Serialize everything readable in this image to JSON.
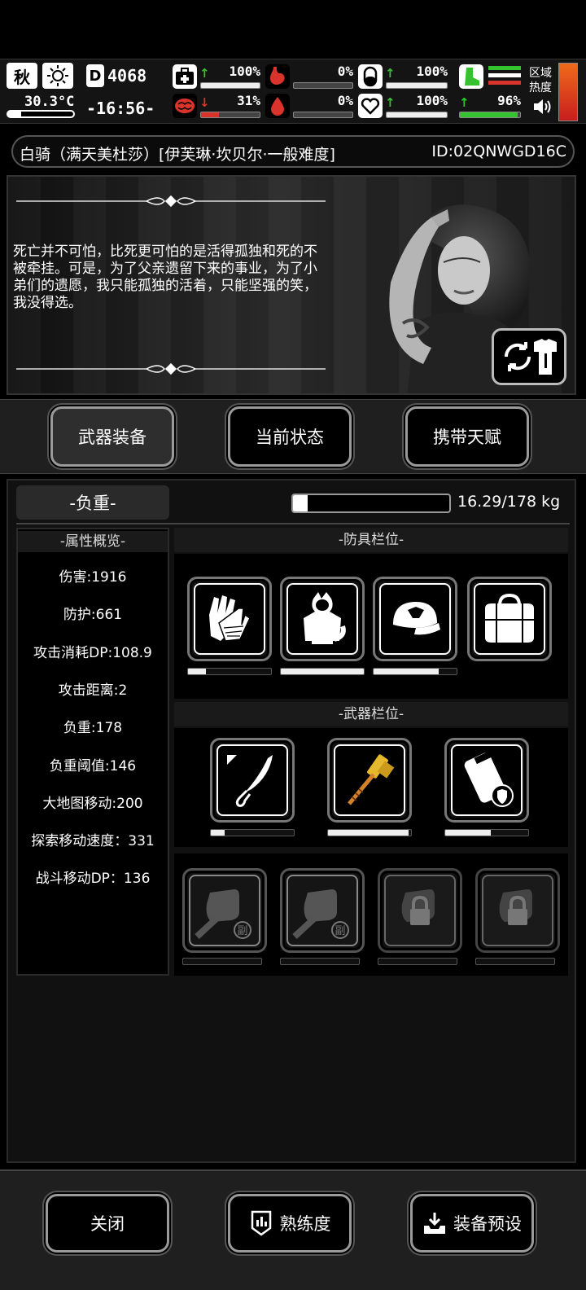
{
  "hud": {
    "season": "秋",
    "temperature": "30.3°C",
    "day": "4068",
    "clock": "-16:56-",
    "zone_label_1": "区域",
    "zone_label_2": "热度",
    "stats": [
      {
        "icon": "medkit-icon",
        "trend": "up",
        "value": "100%",
        "bar": 1.0
      },
      {
        "icon": "stomach-icon",
        "trend": "none",
        "value": "0%",
        "bar": 0.0
      },
      {
        "icon": "pill-icon",
        "trend": "up",
        "value": "100%",
        "bar": 1.0
      },
      {
        "icon": "boot-icon",
        "trend": "none",
        "value": "",
        "bar": 1.0
      },
      {
        "icon": "brain-icon",
        "trend": "down",
        "value": "31%",
        "bar": 0.31
      },
      {
        "icon": "blood-drop-icon",
        "trend": "none",
        "value": "0%",
        "bar": 0.0
      },
      {
        "icon": "heart-icon",
        "trend": "up",
        "value": "100%",
        "bar": 1.0
      },
      {
        "icon": "energy-icon",
        "trend": "up",
        "value": "96%",
        "bar": 0.96
      }
    ]
  },
  "character": {
    "name": "白骑（满天美杜莎）[伊芙琳·坎贝尔·一般难度]",
    "id": "ID:02QNWGD16C",
    "quote": "死亡并不可怕，比死更可怕的是活得孤独和死的不被牵挂。可是，为了父亲遗留下来的事业，为了小弟们的遗愿，我只能孤独的活着，只能坚强的笑，我没得选。"
  },
  "tabs": [
    {
      "label": "武器装备",
      "active": true
    },
    {
      "label": "当前状态",
      "active": false
    },
    {
      "label": "携带天赋",
      "active": false
    }
  ],
  "weight": {
    "label": "-负重-",
    "current": 16.29,
    "max": 178,
    "text": "16.29/178 kg"
  },
  "attributes": {
    "title": "-属性概览-",
    "items": [
      "伤害:1916",
      "防护:661",
      "攻击消耗DP:108.9",
      "攻击距离:2",
      "负重:178",
      "负重阈值:146",
      "大地图移动:200",
      "探索移动速度：331",
      "战斗移动DP：136"
    ]
  },
  "armor": {
    "title": "-防具栏位-",
    "slots": [
      {
        "icon": "gloves-icon",
        "durability": 0.22
      },
      {
        "icon": "hoodie-icon",
        "durability": 1.0
      },
      {
        "icon": "cap-icon",
        "durability": 0.78
      },
      {
        "icon": "bag-icon",
        "durability": 0
      }
    ]
  },
  "weapons": {
    "title": "-武器栏位-",
    "slots": [
      {
        "icon": "curved-blade-icon",
        "durability": 0.17
      },
      {
        "icon": "golden-hammer-icon",
        "durability": 0.97
      },
      {
        "icon": "shield-pack-icon",
        "durability": 0.55
      }
    ]
  },
  "extra_slots": [
    {
      "icon": "fist-icon",
      "badge": "副",
      "locked": false
    },
    {
      "icon": "fist-icon",
      "badge": "副",
      "locked": false
    },
    {
      "icon": "lock-icon",
      "badge": "",
      "locked": true
    },
    {
      "icon": "lock-icon",
      "badge": "",
      "locked": true
    }
  ],
  "footer": {
    "close": "关闭",
    "proficiency": "熟练度",
    "preset": "装备预设"
  },
  "colors": {
    "accent_red": "#d9342b",
    "accent_green": "#35c22f",
    "panel": "#111111"
  }
}
